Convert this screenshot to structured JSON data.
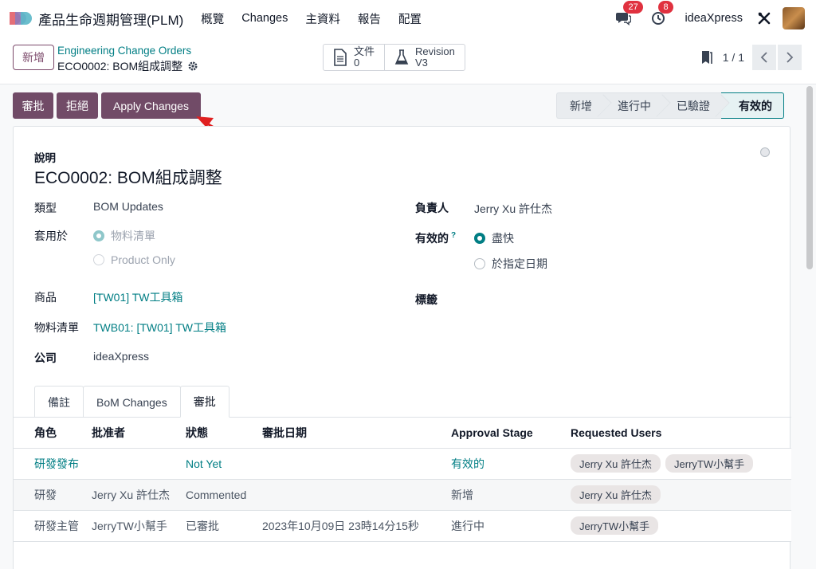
{
  "nav": {
    "app_title": "產品生命週期管理(PLM)",
    "menu": [
      "概覽",
      "Changes",
      "主資料",
      "報告",
      "配置"
    ],
    "messages_count": "27",
    "activities_count": "8",
    "company": "ideaXpress",
    "icons": [
      "app-logo-icon",
      "chat-icon",
      "clock-icon",
      "tools-icon"
    ]
  },
  "control": {
    "new_label": "新增",
    "breadcrumb": "Engineering Change Orders",
    "record_title": "ECO0002: BOM組成調整",
    "docs_label": "文件",
    "docs_count": "0",
    "revision_label": "Revision",
    "revision_value": "V3",
    "pager": "1 / 1"
  },
  "actions": {
    "approve": "審批",
    "reject": "拒絕",
    "apply": "Apply Changes"
  },
  "stages": [
    "新增",
    "進行中",
    "已驗證",
    "有效的"
  ],
  "form": {
    "description_label": "說明",
    "title": "ECO0002: BOM組成調整",
    "type_label": "類型",
    "type_value": "BOM Updates",
    "apply_on_label": "套用於",
    "apply_on_options": [
      "物料清單",
      "Product Only"
    ],
    "product_label": "商品",
    "product_value": "[TW01] TW工具箱",
    "bom_label": "物料清單",
    "bom_value": "TWB01: [TW01] TW工具箱",
    "company_label": "公司",
    "company_value": "ideaXpress",
    "responsible_label": "負責人",
    "responsible_value": "Jerry Xu 許仕杰",
    "effective_label": "有效的",
    "effective_help": "?",
    "effective_options": [
      "盡快",
      "於指定日期"
    ],
    "tags_label": "標籤"
  },
  "tabs": [
    "備註",
    "BoM Changes",
    "審批"
  ],
  "approvals": {
    "headers": [
      "角色",
      "批准者",
      "狀態",
      "審批日期",
      "Approval Stage",
      "Requested Users"
    ],
    "rows": [
      {
        "role": "研發發布",
        "approver": "",
        "status": "Not Yet",
        "date": "",
        "stage": "有效的",
        "users": [
          "Jerry Xu 許仕杰",
          "JerryTW小幫手"
        ]
      },
      {
        "role": "研發",
        "approver": "Jerry Xu 許仕杰",
        "status": "Commented",
        "date": "",
        "stage": "新增",
        "users": [
          "Jerry Xu 許仕杰"
        ]
      },
      {
        "role": "研發主管",
        "approver": "JerryTW小幫手",
        "status": "已審批",
        "date": "2023年10月09日 23時14分15秒",
        "stage": "進行中",
        "users": [
          "JerryTW小幫手"
        ]
      }
    ]
  },
  "colors": {
    "primary": "#714b67",
    "link": "#017e84",
    "badge": "#e0313f",
    "arrow": "#e02020"
  }
}
